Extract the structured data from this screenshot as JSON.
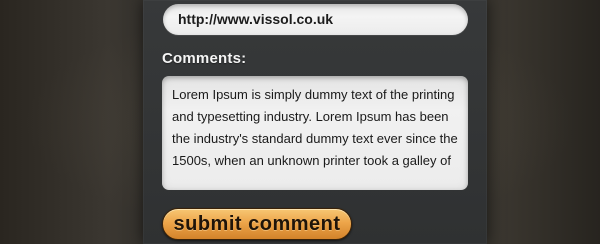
{
  "form": {
    "website_value": "http://www.vissol.co.uk",
    "comments_label": "Comments:",
    "comments_value": "Lorem Ipsum is simply dummy text of the printing\nand typesetting industry. Lorem Ipsum has been\nthe industry's standard dummy text ever since the\n1500s, when an unknown printer took a galley of",
    "submit_label": "submit comment"
  },
  "colors": {
    "panel_background": "#353738",
    "field_background": "#eeeeee",
    "button_top": "#f7c774",
    "button_bottom": "#d3832a",
    "label_text": "#f5f5f5"
  }
}
